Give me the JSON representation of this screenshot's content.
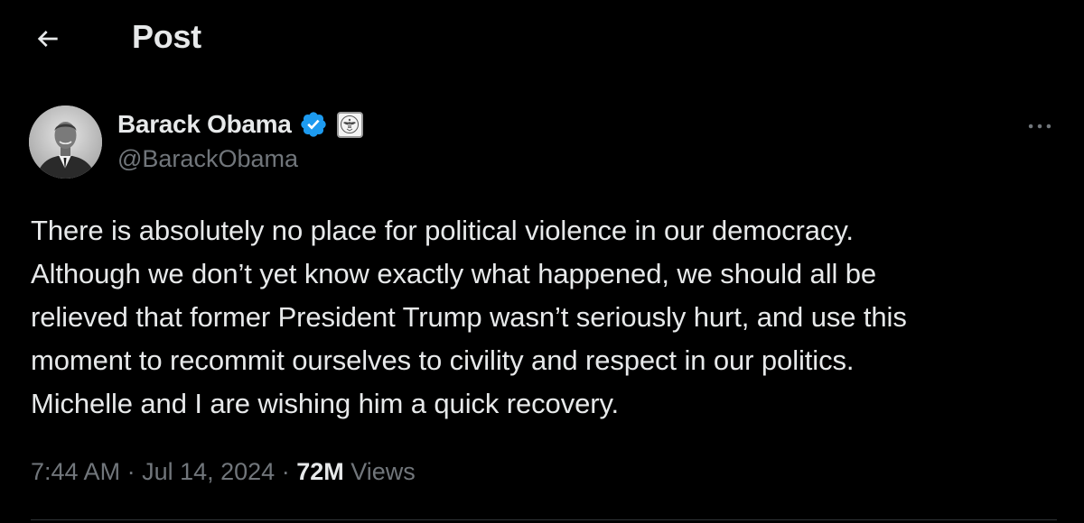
{
  "header": {
    "back_icon": "arrow-left-icon",
    "title": "Post"
  },
  "author": {
    "display_name": "Barack Obama",
    "handle": "@BarackObama",
    "verified_icon": "verified-badge-icon",
    "affiliation_icon": "us-government-seal-icon",
    "verified_color": "#1d9bf0"
  },
  "more_icon": "more-options-icon",
  "tweet": {
    "lines": [
      "There is absolutely no place for political violence in our democracy.",
      "Although we don’t yet know exactly what happened, we should all be",
      "relieved that former President Trump wasn’t seriously hurt, and use this",
      "moment to recommit ourselves to civility and respect in our politics.",
      "Michelle and I are wishing him a quick recovery."
    ]
  },
  "meta": {
    "time": "7:44 AM",
    "separator": " · ",
    "date": "Jul 14, 2024",
    "views_count": "72M",
    "views_label": " Views"
  },
  "colors": {
    "background": "#000000",
    "text_primary": "#e7e9ea",
    "text_secondary": "#71767b",
    "divider": "#2f3336"
  }
}
